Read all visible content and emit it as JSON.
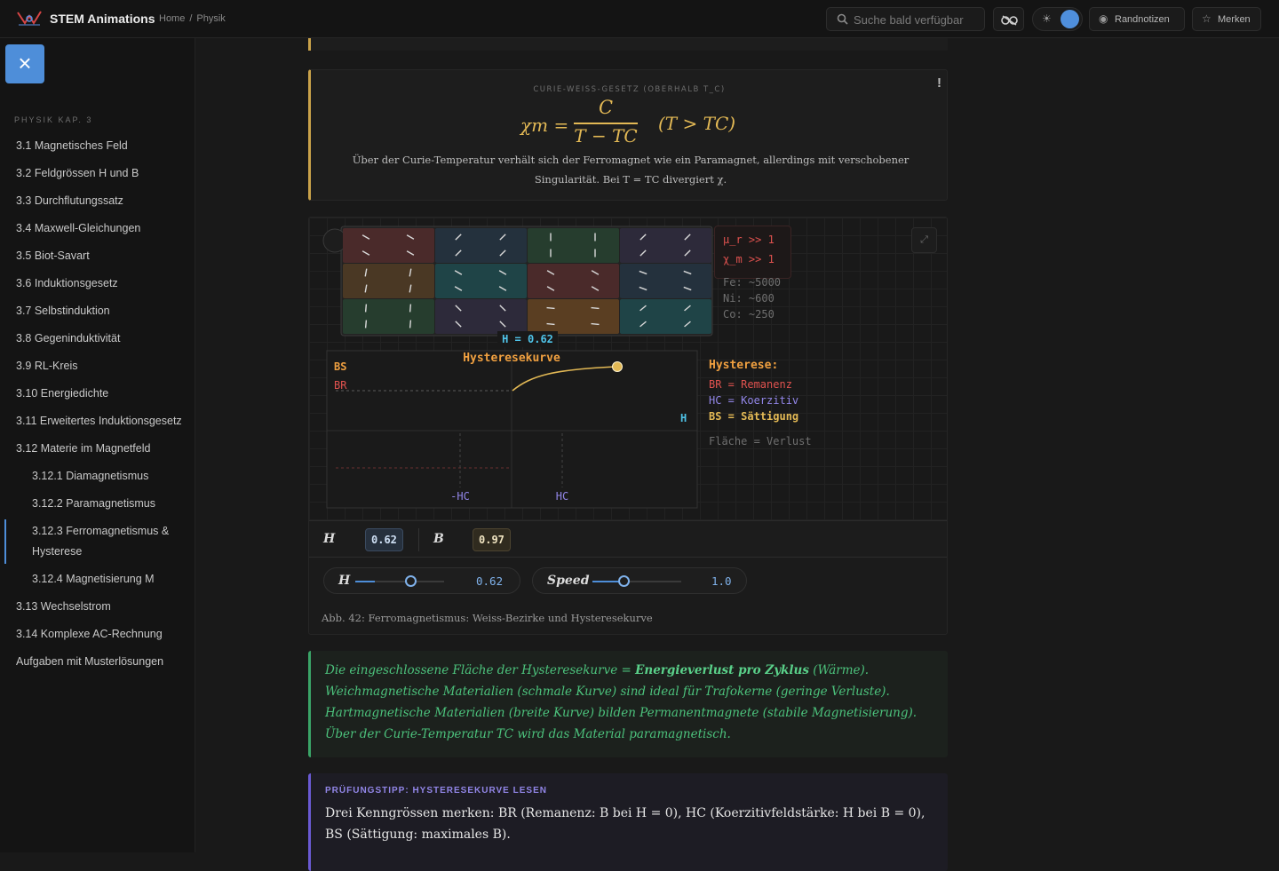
{
  "header": {
    "brand": "STEM Animations",
    "breadcrumb": [
      "Home",
      "/",
      "Physik"
    ],
    "search_placeholder": "Suche bald verfügbar",
    "theme_icon": "sun-icon",
    "notes_label": "Randnotizen",
    "bookmark_label": "Merken"
  },
  "sidebar": {
    "close_icon": "×",
    "heading": "PHYSIK KAP. 3",
    "items": [
      {
        "label": "3.1 Magnetisches Feld"
      },
      {
        "label": "3.2 Feldgrössen H und B"
      },
      {
        "label": "3.3 Durchflutungssatz"
      },
      {
        "label": "3.4 Maxwell-Gleichungen"
      },
      {
        "label": "3.5 Biot-Savart"
      },
      {
        "label": "3.6 Induktionsgesetz"
      },
      {
        "label": "3.7 Selbstinduktion"
      },
      {
        "label": "3.8 Gegeninduktivität"
      },
      {
        "label": "3.9 RL-Kreis"
      },
      {
        "label": "3.10 Energiedichte"
      },
      {
        "label": "3.11 Erweitertes Induktionsgesetz"
      },
      {
        "label": "3.12 Materie im Magnetfeld"
      },
      {
        "label": "3.12.1 Diamagnetismus"
      },
      {
        "label": "3.12.2 Paramagnetismus"
      },
      {
        "label": "3.12.3 Ferromagnetismus & Hysterese"
      },
      {
        "label": "3.12.4 Magnetisierung M"
      },
      {
        "label": "3.13 Wechselstrom"
      },
      {
        "label": "3.14 Komplexe AC-Rechnung"
      },
      {
        "label": "Aufgaben mit Musterlösungen"
      }
    ]
  },
  "formula_card": {
    "title": "CURIE-WEISS-GESETZ (OBERHALB T_C)",
    "excl": "!",
    "lhs": "χm =",
    "numerator": "C",
    "denominator": "T − TC",
    "condition": "(T > TC)",
    "text_1": "Über der Curie-Temperatur verhält sich der Ferromagnet wie ein Paramagnet, allerdings mit verschobener",
    "text_2": "Singularität. Bei T = TC divergiert χ."
  },
  "figure": {
    "domain_count": 12,
    "info_mu": "μ_r >> 1",
    "info_chi": "χ_m >> 1",
    "info_fe": "Fe: ~5000",
    "info_ni": "Ni: ~600",
    "info_co": "Co: ~250",
    "h_label": "H = 0.62",
    "curve_title": "Hysteresekurve",
    "bs": "BS",
    "br": "BR",
    "h_axis": "H",
    "neg_hc": "-HC",
    "hc": "HC",
    "legend_title": "Hysterese:",
    "legend_br": "BR = Remanenz",
    "legend_hc": "HC = Koerzitiv",
    "legend_bs": "BS = Sättigung",
    "legend_area": "Fläche = Verlust",
    "expand_icon": "⤢",
    "readout_h_label": "H",
    "readout_h_value": "0.62",
    "readout_b_label": "B",
    "readout_b_value": "0.97",
    "slider_h_label": "H",
    "slider_h_value": "0.62",
    "slider_h_level": 0.62,
    "slider_speed_label": "Speed",
    "slider_speed_value": "1.0",
    "slider_speed_level": 0.35,
    "caption": "Abb. 42: Ferromagnetismus: Weiss-Bezirke und Hysteresekurve"
  },
  "insight": {
    "line1_a": "Die eingeschlossene Fläche der Hysteresekurve = ",
    "line1_b": "Energieverlust pro Zyklus",
    "line1_c": " (Wärme).",
    "line2": "Weichmagnetische Materialien (schmale Kurve) sind ideal für Trafokerne (geringe Verluste).",
    "line3": "Hartmagnetische Materialien (breite Kurve) bilden Permanentmagnete (stabile Magnetisierung).",
    "line4": "Über der Curie-Temperatur TC wird das Material paramagnetisch."
  },
  "tip": {
    "title": "PRÜFUNGSTIPP: HYSTERESEKURVE LESEN",
    "line1": "Drei Kenngrössen merken: BR (Remanenz: B bei H = 0), HC (Koerzitivfeldstärke: H bei B = 0),",
    "line2": "BS (Sättigung: maximales B)."
  },
  "colors": {
    "accent": "#4e8ed9",
    "gold": "#e3b955",
    "green": "#4cc27c",
    "purple": "#9286e8",
    "red": "#e0524f",
    "orange": "#f0a040",
    "cyan": "#4fc3e8"
  }
}
